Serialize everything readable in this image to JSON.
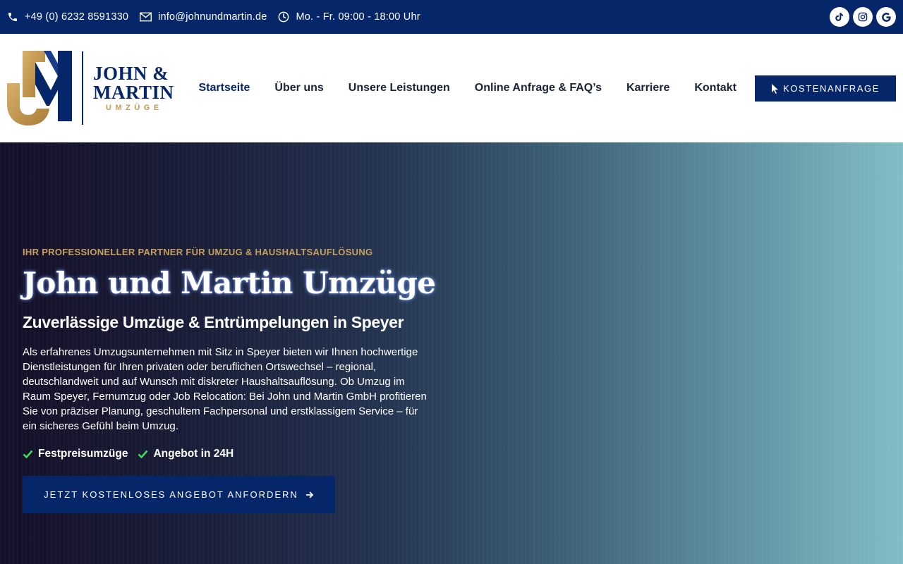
{
  "topbar": {
    "phone": "+49 (0) 6232 8591330",
    "email": "info@johnundmartin.de",
    "hours": "Mo. - Fr. 09:00 - 18:00 Uhr",
    "social": [
      {
        "icon": "tiktok-icon"
      },
      {
        "icon": "instagram-icon"
      },
      {
        "icon": "google-icon"
      }
    ]
  },
  "logo": {
    "line1": "JOHN &",
    "line2": "MARTIN",
    "line3": "UMZÜGE",
    "colors": {
      "navy": "#06266a",
      "gold": "#c19a52"
    }
  },
  "nav": {
    "items": [
      {
        "label": "Startseite",
        "active": true
      },
      {
        "label": "Über uns"
      },
      {
        "label": "Unsere Leistungen"
      },
      {
        "label": "Online Anfrage & FAQ’s"
      },
      {
        "label": "Karriere"
      },
      {
        "label": "Kontakt"
      }
    ],
    "cta_label": "KOSTENANFRAGE"
  },
  "hero": {
    "eyebrow": "IHR PROFESSIONELLER PARTNER FÜR UMZUG & HAUSHALTSAUFLÖSUNG",
    "title": "John und Martin Umzüge",
    "subtitle": "Zuverlässige Umzüge & Entrümpelungen in Speyer",
    "text": "Als erfahrenes Umzugsunternehmen mit Sitz in Speyer bieten wir Ihnen hochwertige Dienstleistungen für Ihren privaten oder beruflichen Ortswechsel – regional, deutschlandweit und auf Wunsch mit diskreter Haushaltsauflösung. Ob Umzug im Raum Speyer, Fernumzug oder Job Relocation: Bei John und Martin GmbH profitieren Sie von präziser Planung, geschultem Fachpersonal und erstklassigem Service – für ein sicheres Gefühl beim Umzug.",
    "checks": [
      "Festpreisumzüge",
      "Angebot in 24H"
    ],
    "button_label": "JETZT KOSTENLOSES ANGEBOT ANFORDERN",
    "colors": {
      "accent": "#c5a05e",
      "check": "#3ddc5a",
      "button": "#06266a"
    }
  }
}
